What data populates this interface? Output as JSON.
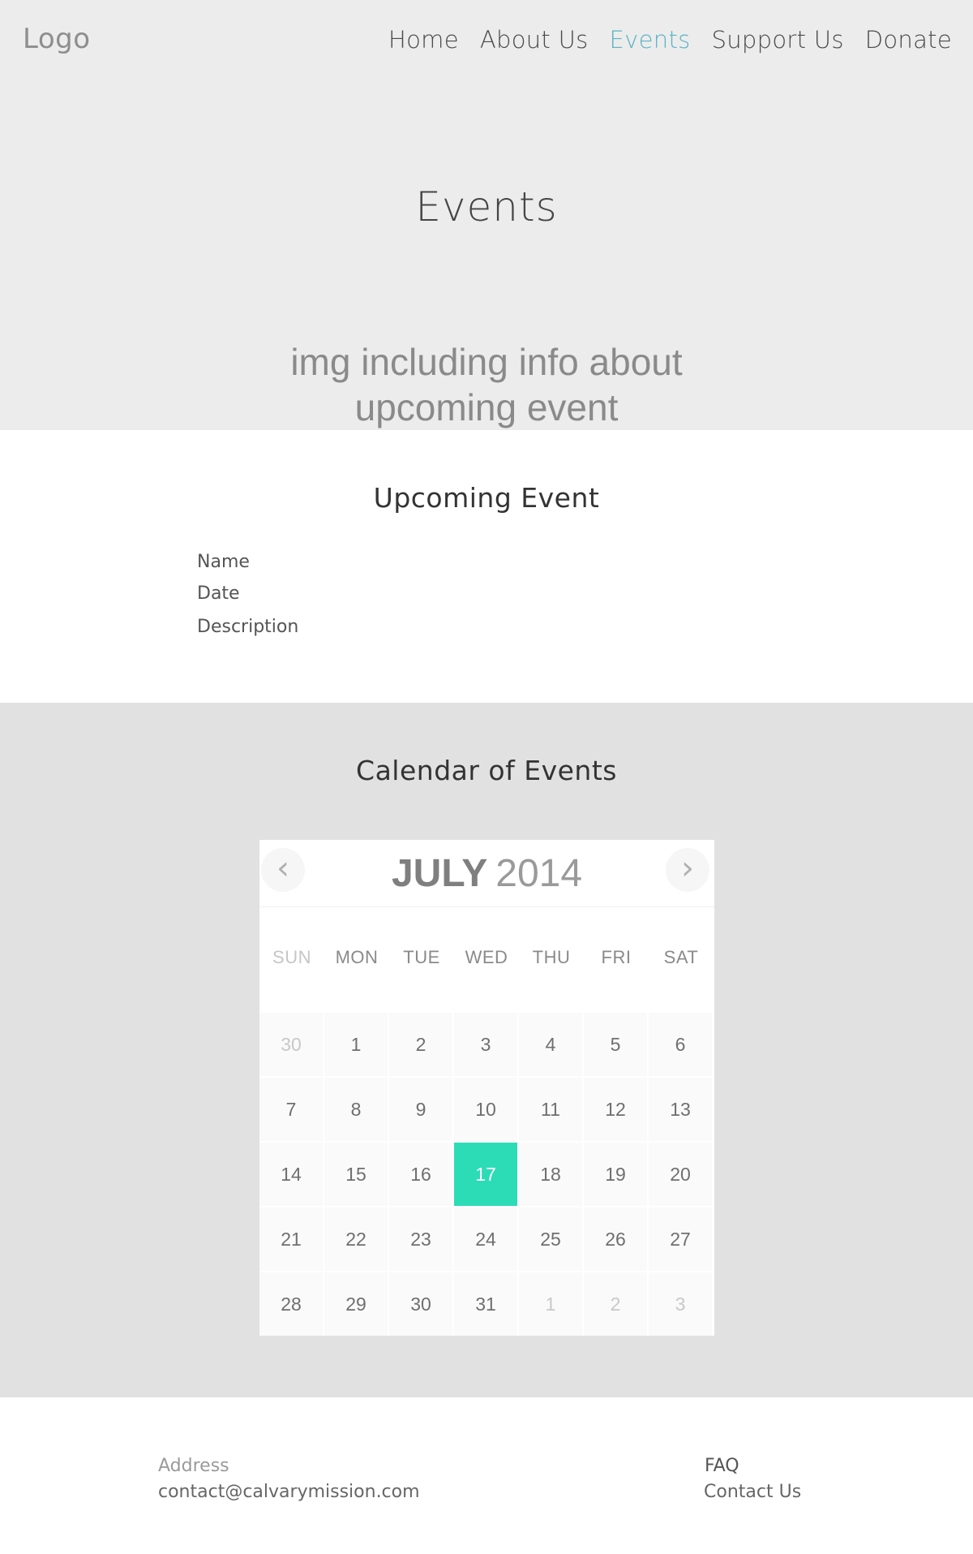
{
  "header": {
    "logo": "Logo",
    "nav": [
      {
        "label": "Home",
        "active": false
      },
      {
        "label": "About Us",
        "active": false
      },
      {
        "label": "Events",
        "active": true
      },
      {
        "label": "Support Us",
        "active": false
      },
      {
        "label": "Donate",
        "active": false
      }
    ],
    "accent_color": "#5ab4c5"
  },
  "hero": {
    "title": "Events",
    "image_caption": "img including info about upcoming event"
  },
  "upcoming": {
    "title": "Upcoming Event",
    "fields": [
      "Name",
      "Date",
      "Description"
    ]
  },
  "calendar_section": {
    "title": "Calendar of Events",
    "calendar": {
      "month": "JULY",
      "year": "2014",
      "prev_icon": "chevron-left-icon",
      "next_icon": "chevron-right-icon",
      "weekdays": [
        "SUN",
        "MON",
        "TUE",
        "WED",
        "THU",
        "FRI",
        "SAT"
      ],
      "days": [
        {
          "label": "30",
          "muted": true
        },
        {
          "label": "1"
        },
        {
          "label": "2"
        },
        {
          "label": "3"
        },
        {
          "label": "4"
        },
        {
          "label": "5"
        },
        {
          "label": "6"
        },
        {
          "label": "7"
        },
        {
          "label": "8"
        },
        {
          "label": "9"
        },
        {
          "label": "10"
        },
        {
          "label": "11"
        },
        {
          "label": "12"
        },
        {
          "label": "13"
        },
        {
          "label": "14"
        },
        {
          "label": "15"
        },
        {
          "label": "16"
        },
        {
          "label": "17",
          "selected": true
        },
        {
          "label": "18"
        },
        {
          "label": "19"
        },
        {
          "label": "20"
        },
        {
          "label": "21"
        },
        {
          "label": "22"
        },
        {
          "label": "23"
        },
        {
          "label": "24"
        },
        {
          "label": "25"
        },
        {
          "label": "26"
        },
        {
          "label": "27"
        },
        {
          "label": "28"
        },
        {
          "label": "29"
        },
        {
          "label": "30"
        },
        {
          "label": "31"
        },
        {
          "label": "1",
          "muted": true
        },
        {
          "label": "2",
          "muted": true
        },
        {
          "label": "3",
          "muted": true
        }
      ],
      "selected_color": "#2cdcb6"
    }
  },
  "footer": {
    "address_label": "Address",
    "email": "contact@calvarymission.com",
    "faq": "FAQ",
    "contact": "Contact Us"
  }
}
